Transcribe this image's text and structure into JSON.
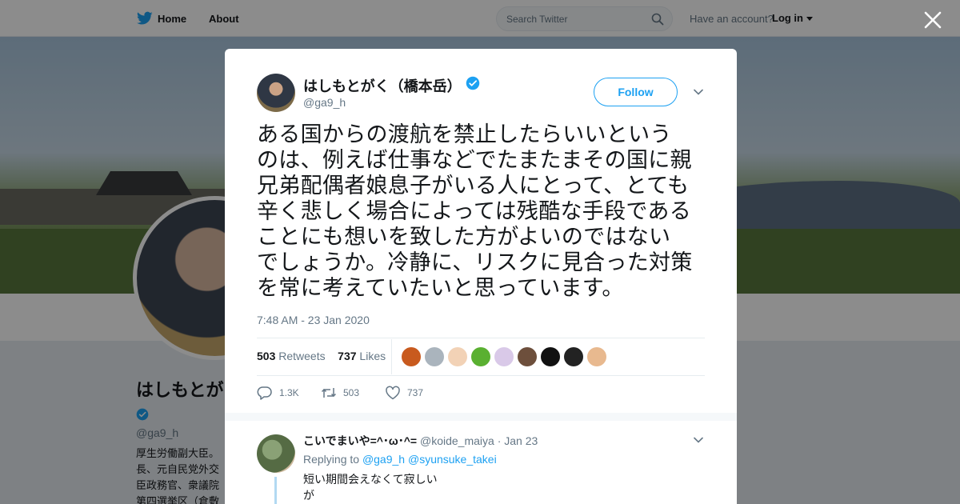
{
  "topnav": {
    "home_label": "Home",
    "about_label": "About",
    "search_placeholder": "Search Twitter",
    "have_account": "Have an account?",
    "login_label": "Log in"
  },
  "profile_bg": {
    "name": "はしもとが",
    "handle": "@ga9_h",
    "bio_lines": [
      "厚生労働副大臣。",
      "長、元自民党外交",
      "臣政務官、衆議院",
      "第四選挙区（倉敷"
    ]
  },
  "tweet": {
    "author_name": "はしもとがく（橋本岳）",
    "author_handle": "@ga9_h",
    "follow_label": "Follow",
    "text_lines": [
      "ある国からの渡航を禁止したらいいという",
      "のは、例えば仕事などでたまたまその国に親",
      "兄弟配偶者娘息子がいる人にとって、とても",
      "辛く悲しく場合によっては残酷な手段である",
      "ことにも想いを致した方がよいのではない",
      "でしょうか。冷静に、リスクに見合った対策",
      "を常に考えていたいと思っています。"
    ],
    "timestamp": "7:48 AM - 23 Jan 2020",
    "retweets_count": "503",
    "retweets_label": "Retweets",
    "likes_count": "737",
    "likes_label": "Likes",
    "reply_count": "1.3K",
    "retweet_action_count": "503",
    "like_action_count": "737",
    "liker_colors": [
      "#c85a1e",
      "#aab4bd",
      "#f2d2b6",
      "#5ab031",
      "#d9c9e8",
      "#6d4f3c",
      "#111111",
      "#222222",
      "#e8b98f"
    ]
  },
  "reply": {
    "name": "こいでまいや=^･ω･^=",
    "handle": "@koide_maiya",
    "date": "· Jan 23",
    "replying_to_label": "Replying to",
    "replying_to_1": "@ga9_h",
    "replying_to_2": "@syunsuke_takei",
    "text_line1": "短い期間会えなくて寂しい",
    "text_line2": "が"
  }
}
